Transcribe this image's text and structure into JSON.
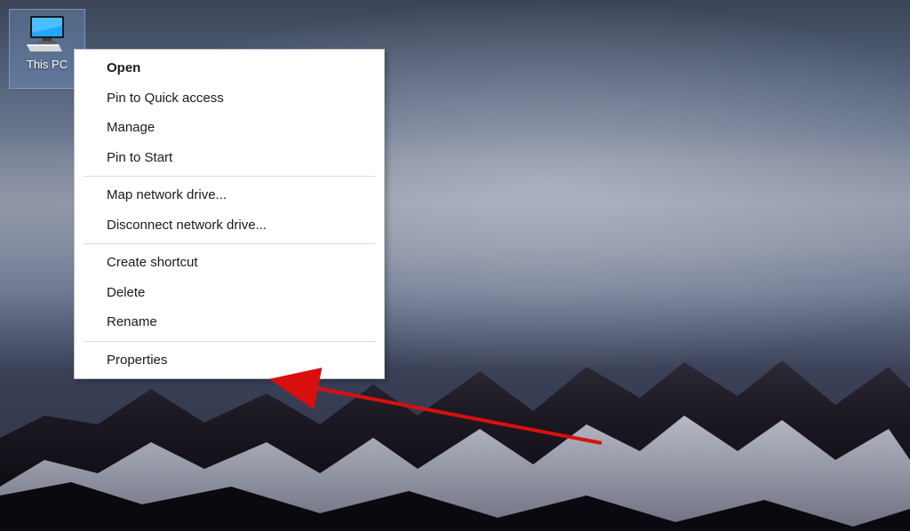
{
  "desktop": {
    "icon": {
      "label": "This PC",
      "semantic": "this-pc-icon"
    }
  },
  "context_menu": {
    "groups": [
      {
        "items": [
          {
            "label": "Open",
            "bold": true
          },
          {
            "label": "Pin to Quick access"
          },
          {
            "label": "Manage"
          },
          {
            "label": "Pin to Start"
          }
        ]
      },
      {
        "items": [
          {
            "label": "Map network drive..."
          },
          {
            "label": "Disconnect network drive..."
          }
        ]
      },
      {
        "items": [
          {
            "label": "Create shortcut"
          },
          {
            "label": "Delete"
          },
          {
            "label": "Rename"
          }
        ]
      },
      {
        "items": [
          {
            "label": "Properties"
          }
        ]
      }
    ]
  },
  "annotation": {
    "color": "#d90f0f"
  }
}
